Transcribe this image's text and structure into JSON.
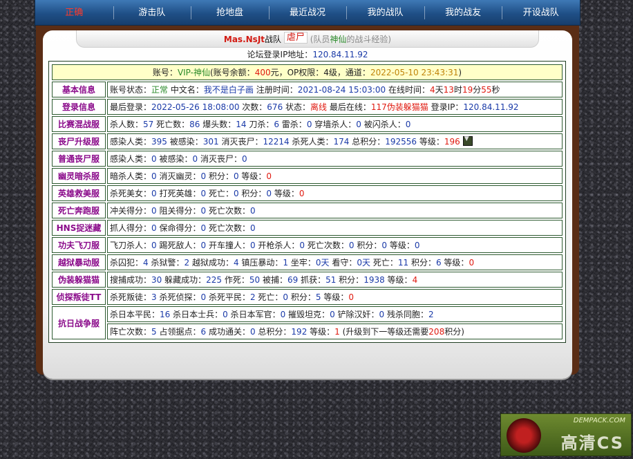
{
  "nav": [
    {
      "label": "正确"
    },
    {
      "label": "游击队"
    },
    {
      "label": "抢地盘"
    },
    {
      "label": "最近战况"
    },
    {
      "label": "我的战队"
    },
    {
      "label": "我的战友"
    },
    {
      "label": "开设战队"
    }
  ],
  "title": {
    "team": "Mas.NsJt",
    "word": "战队",
    "role": "虐尸",
    "paren_open": "(队员",
    "member": "神仙",
    "paren_close": "的战斗经验)"
  },
  "ip": {
    "label": "论坛登录IP地址：",
    "value": "120.84.11.92"
  },
  "account": {
    "p1": "账号：",
    "name": "VIP-神仙",
    "p2": "(账号余额：",
    "balance": "400",
    "p3": "元，OP权限：",
    "op": "4级",
    "p4": "，通道：",
    "time": "2022-05-10 23:43:31",
    "p5": ")"
  },
  "rows": {
    "basic": {
      "label": "基本信息",
      "s1": "账号状态：",
      "status": "正常",
      "s2": " 中文名：",
      "cn": "我不是白子画",
      "s3": " 注册时间：",
      "reg": "2021-08-24 15:03:00",
      "s4": " 在线时间：",
      "d": "4",
      "du": "天",
      "h": "13",
      "hu": "时",
      "m": "19",
      "mu": "分",
      "s": "55",
      "su": "秒"
    },
    "login": {
      "label": "登录信息",
      "s1": "最后登录：",
      "last": "2022-05-26 18:08:00",
      "s2": " 次数：",
      "count": "676",
      "s3": " 状态：",
      "state": "离线",
      "s4": " 最后在线：",
      "where": "117伪装躲猫猫",
      "s5": " 登录IP：",
      "ip": "120.84.11.92"
    },
    "mix": {
      "label": "比赛混战服",
      "a": "杀人数：",
      "av": "57",
      "b": " 死亡数：",
      "bv": "86",
      "c": " 爆头数：",
      "cv": "14",
      "d": " 刀杀：",
      "dv": "6",
      "e": " 雷杀：",
      "ev": "0",
      "f": " 穿墙杀人：",
      "fv": "0",
      "g": " 被闪杀人：",
      "gv": "0"
    },
    "zombie_up": {
      "label": "丧尸升级服",
      "a": "感染人类：",
      "av": "395",
      "b": " 被感染：",
      "bv": "301",
      "c": " 消灭丧尸：",
      "cv": "12214",
      "d": " 杀死人类：",
      "dv": "174",
      "e": " 总积分：",
      "ev": "192556",
      "f": " 等级：",
      "fv": "196"
    },
    "zombie": {
      "label": "普通丧尸服",
      "a": "感染人类：",
      "av": "0",
      "b": " 被感染：",
      "bv": "0",
      "c": " 消灭丧尸：",
      "cv": "0"
    },
    "ghost": {
      "label": "幽灵暗杀服",
      "a": "暗杀人类：",
      "av": "0",
      "b": " 消灭幽灵：",
      "bv": "0",
      "c": " 积分：",
      "cv": "0",
      "d": " 等级：",
      "dv": "0"
    },
    "hero": {
      "label": "英雄救美服",
      "a": "杀死美女：",
      "av": "0",
      "b": " 打死英雄：",
      "bv": "0",
      "c": " 死亡：",
      "cv": "0",
      "d": " 积分：",
      "dv": "0",
      "e": " 等级：",
      "ev": "0"
    },
    "death_run": {
      "label": "死亡奔跑服",
      "a": "冲关得分：",
      "av": "0",
      "b": " 阻关得分：",
      "bv": "0",
      "c": " 死亡次数：",
      "cv": "0"
    },
    "hns": {
      "label": "HNS捉迷藏",
      "a": "抓人得分：",
      "av": "0",
      "b": " 保命得分：",
      "bv": "0",
      "c": " 死亡次数：",
      "cv": "0"
    },
    "kungfu": {
      "label": "功夫飞刀服",
      "a": "飞刀杀人：",
      "av": "0",
      "b": " 踢死敌人：",
      "bv": "0",
      "c": " 开车撞人：",
      "cv": "0",
      "d": " 开枪杀人：",
      "dv": "0",
      "e": " 死亡次数：",
      "ev": "0",
      "f": " 积分：",
      "fv": "0",
      "g": " 等级：",
      "gv": "0"
    },
    "jail": {
      "label": "越狱暴动服",
      "a": "杀囚犯：",
      "av": "4",
      "b": " 杀狱警：",
      "bv": "2",
      "c": " 越狱成功：",
      "cv": "4",
      "d": " 镇压暴动：",
      "dv": "1",
      "e": " 坐牢：",
      "ev": "0",
      "eu": "天",
      "f": " 看守：",
      "fv": "0",
      "fu": "天",
      "g": " 死亡：",
      "gv": "11",
      "h": " 积分：",
      "hv": "6",
      "i": " 等级：",
      "iv": "0"
    },
    "hide": {
      "label": "伪装躲猫猫",
      "a": "搜捕成功：",
      "av": "30",
      "b": " 躲藏成功：",
      "bv": "225",
      "c": " 作死：",
      "cv": "50",
      "d": " 被捕：",
      "dv": "69",
      "e": " 抓获：",
      "ev": "51",
      "f": " 积分：",
      "fv": "1938",
      "g": " 等级：",
      "gv": "4"
    },
    "traitor": {
      "label": "侦探叛徒TT",
      "a": "杀死叛徒：",
      "av": "3",
      "b": " 杀死侦探：",
      "bv": "0",
      "c": " 杀死平民：",
      "cv": "2",
      "d": " 死亡：",
      "dv": "0",
      "e": " 积分：",
      "ev": "5",
      "f": " 等级：",
      "fv": "0"
    },
    "war": {
      "label": "抗日战争服",
      "a": "杀日本平民：",
      "av": "16",
      "b": " 杀日本士兵：",
      "bv": "0",
      "c": " 杀日本军官：",
      "cv": "0",
      "d": " 摧毁坦克：",
      "dv": "0",
      "e": " 铲除汉奸：",
      "ev": "0",
      "f": " 残杀同胞：",
      "fv": "2",
      "g": "阵亡次数：",
      "gv": "5",
      "h": " 占领据点：",
      "hv": "6",
      "i": " 成功通关：",
      "iv": "0",
      "j": " 总积分：",
      "jv": "192",
      "k": " 等级：",
      "kv": "1",
      "l": " (升级到下一等级还需要",
      "lv": "208",
      "m": "积分)"
    }
  },
  "watermark": {
    "url": "DEMPACK.COM",
    "text": "高清CS"
  }
}
